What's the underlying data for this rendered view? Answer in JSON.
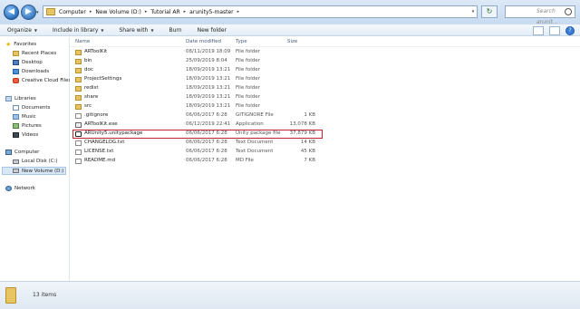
{
  "address": {
    "crumbs": [
      "Computer",
      "New Volume (D:)",
      "Tutorial AR",
      "arunity5-master"
    ],
    "search_placeholder": "Search arunit..."
  },
  "toolbar": {
    "organize": "Organize",
    "include": "Include in library",
    "share": "Share with",
    "burn": "Burn",
    "new_folder": "New folder"
  },
  "nav": {
    "favorites": "Favorites",
    "recent_places": "Recent Places",
    "desktop": "Desktop",
    "downloads": "Downloads",
    "creative_cloud": "Creative Cloud Files",
    "libraries": "Libraries",
    "documents": "Documents",
    "music": "Music",
    "pictures": "Pictures",
    "videos": "Videos",
    "computer": "Computer",
    "local_disk": "Local Disk (C:)",
    "new_volume": "New Volume (D:)",
    "network": "Network"
  },
  "columns": {
    "name": "Name",
    "date": "Date modified",
    "type": "Type",
    "size": "Size"
  },
  "files": [
    {
      "name": "ARToolKit",
      "date": "08/11/2019 18:09",
      "type": "File folder",
      "size": "",
      "icon": "folder"
    },
    {
      "name": "bin",
      "date": "25/09/2019 8:04",
      "type": "File folder",
      "size": "",
      "icon": "folder"
    },
    {
      "name": "doc",
      "date": "18/09/2019 13:21",
      "type": "File folder",
      "size": "",
      "icon": "folder"
    },
    {
      "name": "ProjectSettings",
      "date": "18/09/2019 13:21",
      "type": "File folder",
      "size": "",
      "icon": "folder"
    },
    {
      "name": "redist",
      "date": "18/09/2019 13:21",
      "type": "File folder",
      "size": "",
      "icon": "folder"
    },
    {
      "name": "share",
      "date": "18/09/2019 13:21",
      "type": "File folder",
      "size": "",
      "icon": "folder"
    },
    {
      "name": "src",
      "date": "18/09/2019 13:21",
      "type": "File folder",
      "size": "",
      "icon": "folder"
    },
    {
      "name": ".gitignore",
      "date": "06/06/2017 6:28",
      "type": "GITIGNORE File",
      "size": "1 KB",
      "icon": "file"
    },
    {
      "name": "ARToolKit.exe",
      "date": "06/12/2019 22:41",
      "type": "Application",
      "size": "13,078 KB",
      "icon": "exe"
    },
    {
      "name": "ARUnity5.unitypackage",
      "date": "06/06/2017 6:28",
      "type": "Unity package file",
      "size": "37,879 KB",
      "icon": "unity"
    },
    {
      "name": "CHANGELOG.txt",
      "date": "06/06/2017 6:28",
      "type": "Text Document",
      "size": "14 KB",
      "icon": "file"
    },
    {
      "name": "LICENSE.txt",
      "date": "06/06/2017 6:28",
      "type": "Text Document",
      "size": "45 KB",
      "icon": "file"
    },
    {
      "name": "README.md",
      "date": "06/06/2017 6:28",
      "type": "MD File",
      "size": "7 KB",
      "icon": "file"
    }
  ],
  "status": {
    "count": "13 items"
  },
  "colors": {
    "highlight": "#c0212e",
    "toolbar": "#e3ecf6",
    "selection": "#d9e8f7"
  }
}
